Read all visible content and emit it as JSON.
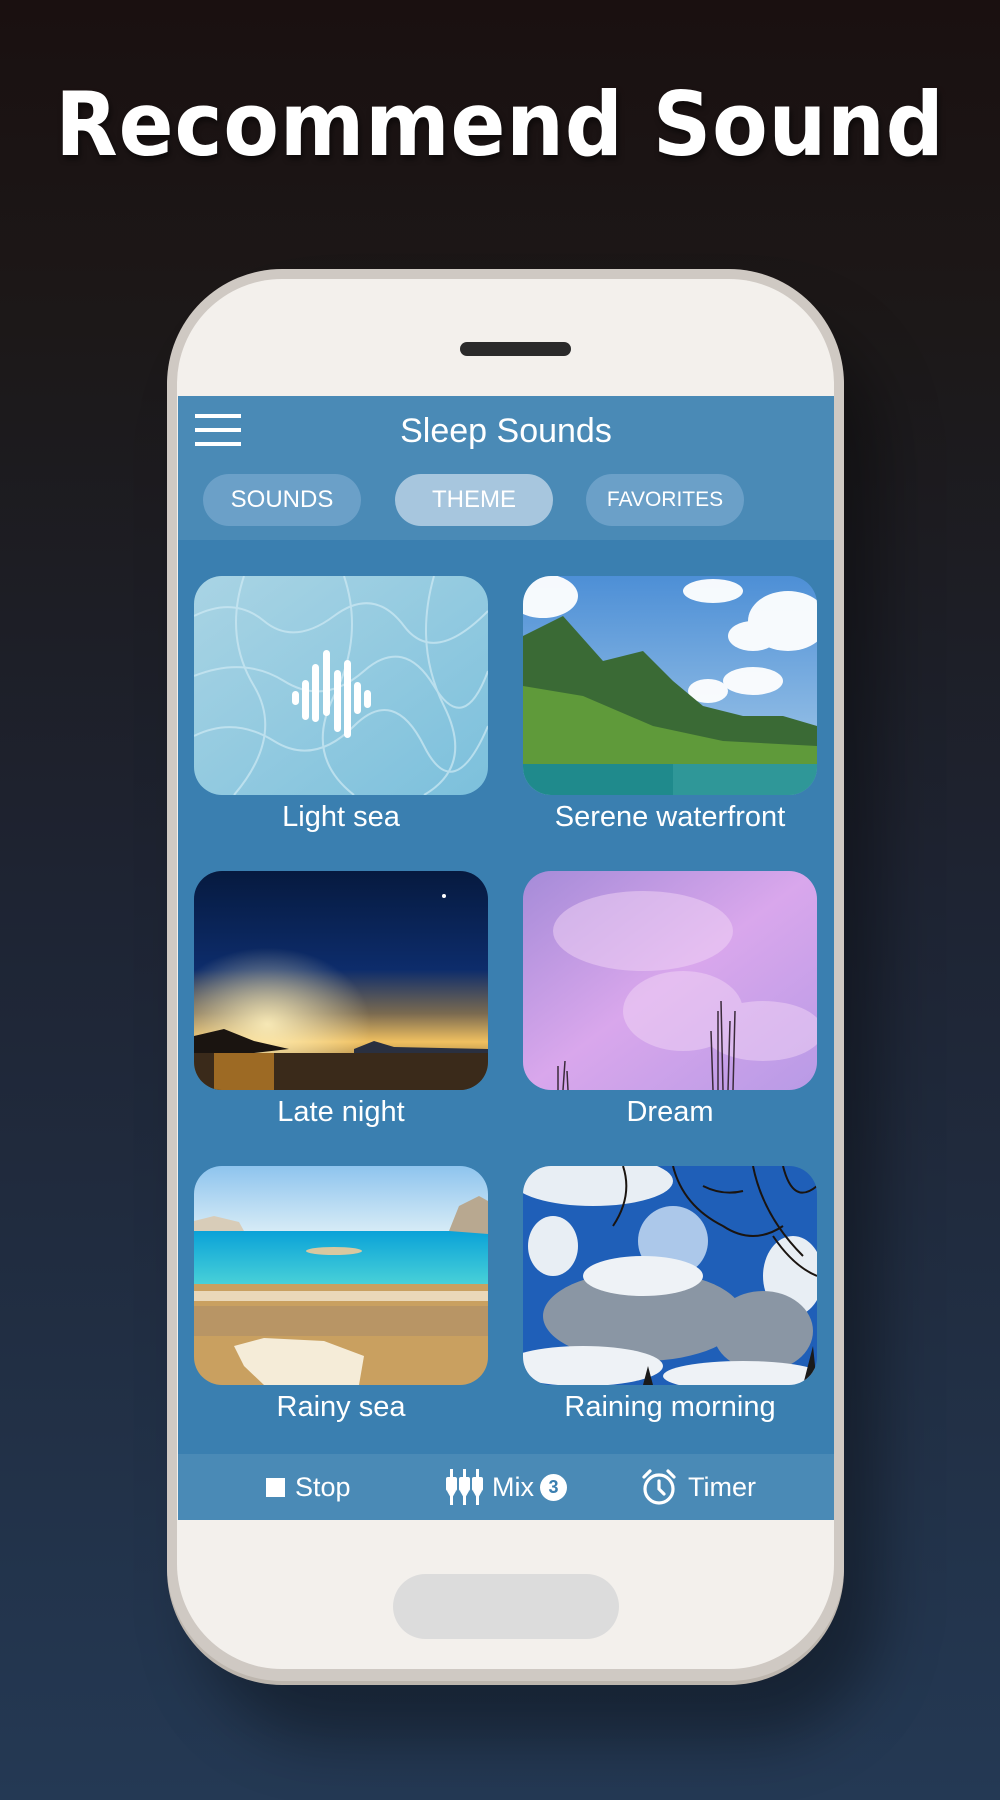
{
  "headline": "Recommend Sound",
  "app": {
    "title": "Sleep Sounds",
    "menu_icon": "hamburger-menu-icon"
  },
  "tabs": [
    {
      "label": "SOUNDS",
      "active": false
    },
    {
      "label": "THEME",
      "active": true
    },
    {
      "label": "FAVORITES",
      "active": false
    }
  ],
  "themes": [
    {
      "label": "Light sea",
      "image": "water-ripple-pool",
      "overlay_icon": "sound-wave-icon"
    },
    {
      "label": "Serene waterfront",
      "image": "green-mountain-lake"
    },
    {
      "label": "Late night",
      "image": "crescent-moon-sunset-sea"
    },
    {
      "label": "Dream",
      "image": "purple-pink-sky"
    },
    {
      "label": "Rainy sea",
      "image": "turquoise-beach"
    },
    {
      "label": "Raining morning",
      "image": "clouds-blue-sky-branches"
    }
  ],
  "bottom_bar": {
    "stop_label": "Stop",
    "mix_label": "Mix",
    "mix_count": "3",
    "timer_label": "Timer"
  },
  "colors": {
    "app_bar": "#4a8ab6",
    "content_bg": "#3a7fb0",
    "tab_active": "#a7c6de",
    "tab_inactive": "#6ba0c8",
    "phone_body": "#f3f0ec"
  }
}
